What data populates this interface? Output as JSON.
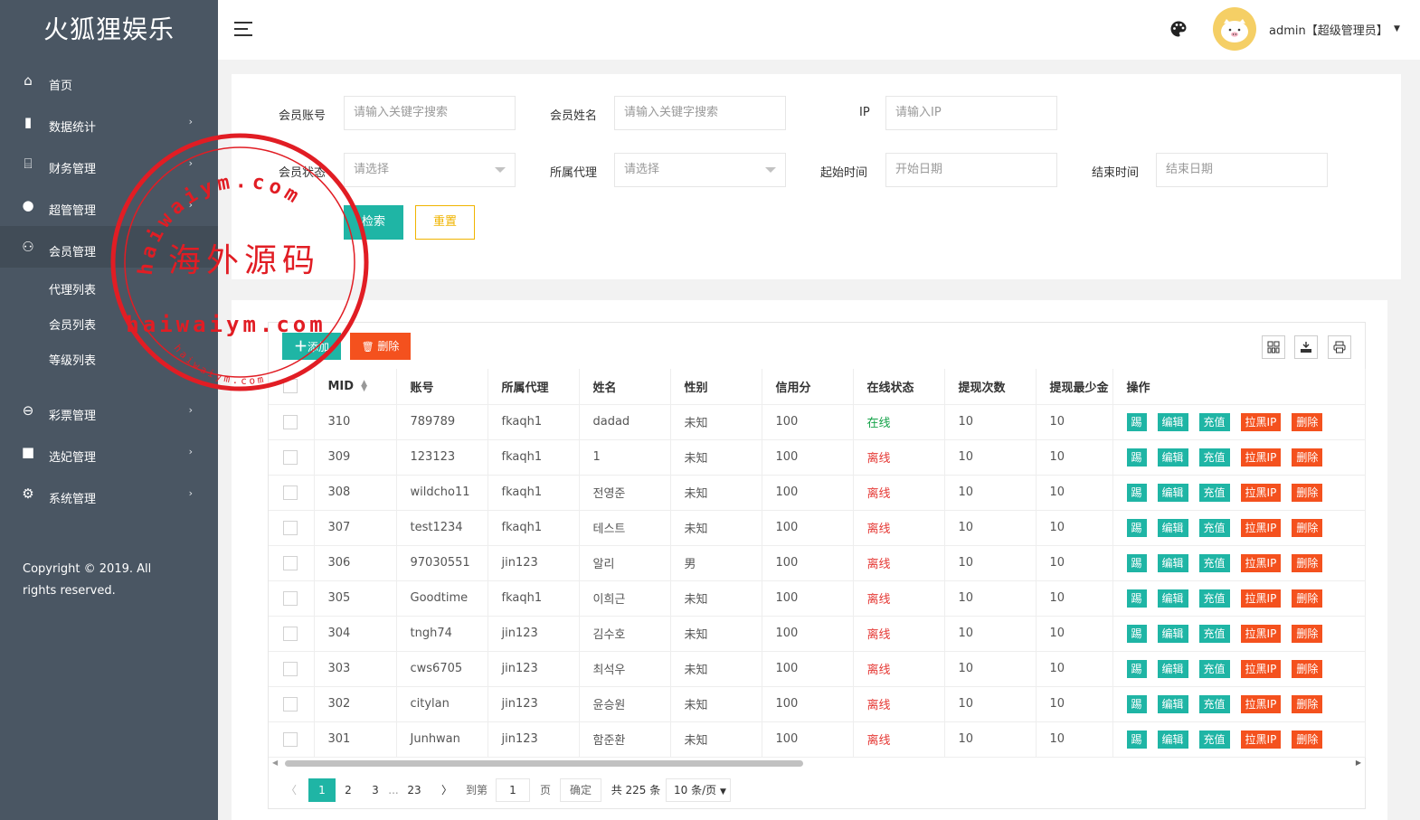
{
  "app": {
    "title": "火狐狸娱乐"
  },
  "sidebar": {
    "items": [
      {
        "label": "首页",
        "icon": "home-icon",
        "has_children": false
      },
      {
        "label": "数据统计",
        "icon": "bar-chart-icon",
        "has_children": true
      },
      {
        "label": "财务管理",
        "icon": "bank-icon",
        "has_children": true
      },
      {
        "label": "超管管理",
        "icon": "user-icon",
        "has_children": true
      },
      {
        "label": "会员管理",
        "icon": "users-icon",
        "has_children": false,
        "active": true
      }
    ],
    "sub_items": [
      "代理列表",
      "会员列表",
      "等级列表"
    ],
    "items_after": [
      {
        "label": "彩票管理",
        "icon": "gamepad-icon",
        "has_children": true
      },
      {
        "label": "选妃管理",
        "icon": "video-icon",
        "has_children": true
      },
      {
        "label": "系统管理",
        "icon": "gear-icon",
        "has_children": true
      }
    ],
    "copyright": "Copyright © 2019. All rights reserved."
  },
  "header": {
    "user_label": "admin【超级管理员】"
  },
  "search": {
    "account_label": "会员账号",
    "account_placeholder": "请输入关键字搜索",
    "name_label": "会员姓名",
    "name_placeholder": "请输入关键字搜索",
    "ip_label": "IP",
    "ip_placeholder": "请输入IP",
    "status_label": "会员状态",
    "status_value": "请选择",
    "agent_label": "所属代理",
    "agent_value": "请选择",
    "start_label": "起始时间",
    "start_placeholder": "开始日期",
    "end_label": "结束时间",
    "end_placeholder": "结束日期",
    "search_button": "检索",
    "reset_button": "重置"
  },
  "toolbar": {
    "add_label": "添加",
    "delete_label": "删除"
  },
  "table": {
    "columns": [
      "MID",
      "账号",
      "所属代理",
      "姓名",
      "性别",
      "信用分",
      "在线状态",
      "提现次数",
      "提现最少金",
      "操作"
    ],
    "rows": [
      {
        "mid": "310",
        "account": "789789",
        "agent": "fkaqh1",
        "name": "dadad",
        "gender": "未知",
        "credit": "100",
        "status": "在线",
        "online": true,
        "withdraw_count": "10",
        "min_withdraw": "10"
      },
      {
        "mid": "309",
        "account": "123123",
        "agent": "fkaqh1",
        "name": "1",
        "gender": "未知",
        "credit": "100",
        "status": "离线",
        "online": false,
        "withdraw_count": "10",
        "min_withdraw": "10"
      },
      {
        "mid": "308",
        "account": "wildcho11",
        "agent": "fkaqh1",
        "name": "전영준",
        "gender": "未知",
        "credit": "100",
        "status": "离线",
        "online": false,
        "withdraw_count": "10",
        "min_withdraw": "10"
      },
      {
        "mid": "307",
        "account": "test1234",
        "agent": "fkaqh1",
        "name": "테스트",
        "gender": "未知",
        "credit": "100",
        "status": "离线",
        "online": false,
        "withdraw_count": "10",
        "min_withdraw": "10"
      },
      {
        "mid": "306",
        "account": "97030551",
        "agent": "jin123",
        "name": "알리",
        "gender": "男",
        "credit": "100",
        "status": "离线",
        "online": false,
        "withdraw_count": "10",
        "min_withdraw": "10"
      },
      {
        "mid": "305",
        "account": "Goodtime",
        "agent": "fkaqh1",
        "name": "이희근",
        "gender": "未知",
        "credit": "100",
        "status": "离线",
        "online": false,
        "withdraw_count": "10",
        "min_withdraw": "10"
      },
      {
        "mid": "304",
        "account": "tngh74",
        "agent": "jin123",
        "name": "김수호",
        "gender": "未知",
        "credit": "100",
        "status": "离线",
        "online": false,
        "withdraw_count": "10",
        "min_withdraw": "10"
      },
      {
        "mid": "303",
        "account": "cws6705",
        "agent": "jin123",
        "name": "최석우",
        "gender": "未知",
        "credit": "100",
        "status": "离线",
        "online": false,
        "withdraw_count": "10",
        "min_withdraw": "10"
      },
      {
        "mid": "302",
        "account": "citylan",
        "agent": "jin123",
        "name": "윤승원",
        "gender": "未知",
        "credit": "100",
        "status": "离线",
        "online": false,
        "withdraw_count": "10",
        "min_withdraw": "10"
      },
      {
        "mid": "301",
        "account": "Junhwan",
        "agent": "jin123",
        "name": "함준환",
        "gender": "未知",
        "credit": "100",
        "status": "离线",
        "online": false,
        "withdraw_count": "10",
        "min_withdraw": "10"
      }
    ],
    "row_actions": [
      "踢",
      "编辑",
      "充值",
      "拉黑IP",
      "删除"
    ]
  },
  "pagination": {
    "current": "1",
    "pages": [
      "2",
      "3"
    ],
    "ellipsis": "...",
    "last": "23",
    "goto_label": "到第",
    "goto_value": "1",
    "page_unit": "页",
    "confirm_label": "确定",
    "total_label": "共 225 条",
    "per_page": "10 条/页"
  },
  "watermark": {
    "text_cn": "海外源码",
    "text_en": "haiwaiym.com",
    "color": "#e11d24"
  },
  "colors": {
    "sidebar_bg": "#4a5663",
    "accent": "#1fb5a5",
    "danger": "#f4511e",
    "warning": "#f0b400",
    "online": "#16a34a",
    "offline": "#e53935"
  }
}
